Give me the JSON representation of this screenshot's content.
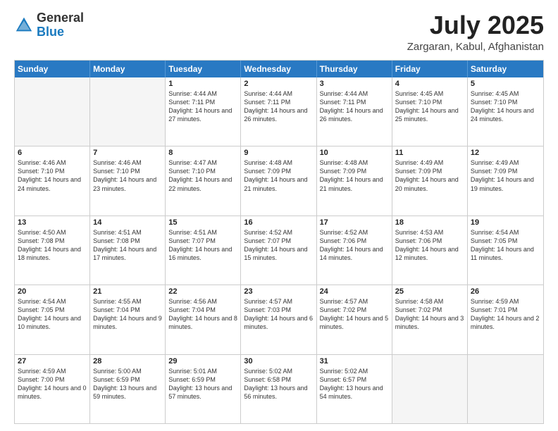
{
  "header": {
    "logo_general": "General",
    "logo_blue": "Blue",
    "month_title": "July 2025",
    "location": "Zargaran, Kabul, Afghanistan"
  },
  "calendar": {
    "days": [
      "Sunday",
      "Monday",
      "Tuesday",
      "Wednesday",
      "Thursday",
      "Friday",
      "Saturday"
    ],
    "rows": [
      [
        {
          "day": "",
          "empty": true
        },
        {
          "day": "",
          "empty": true
        },
        {
          "day": "1",
          "sunrise": "4:44 AM",
          "sunset": "7:11 PM",
          "daylight": "14 hours and 27 minutes."
        },
        {
          "day": "2",
          "sunrise": "4:44 AM",
          "sunset": "7:11 PM",
          "daylight": "14 hours and 26 minutes."
        },
        {
          "day": "3",
          "sunrise": "4:44 AM",
          "sunset": "7:11 PM",
          "daylight": "14 hours and 26 minutes."
        },
        {
          "day": "4",
          "sunrise": "4:45 AM",
          "sunset": "7:10 PM",
          "daylight": "14 hours and 25 minutes."
        },
        {
          "day": "5",
          "sunrise": "4:45 AM",
          "sunset": "7:10 PM",
          "daylight": "14 hours and 24 minutes."
        }
      ],
      [
        {
          "day": "6",
          "sunrise": "4:46 AM",
          "sunset": "7:10 PM",
          "daylight": "14 hours and 24 minutes."
        },
        {
          "day": "7",
          "sunrise": "4:46 AM",
          "sunset": "7:10 PM",
          "daylight": "14 hours and 23 minutes."
        },
        {
          "day": "8",
          "sunrise": "4:47 AM",
          "sunset": "7:10 PM",
          "daylight": "14 hours and 22 minutes."
        },
        {
          "day": "9",
          "sunrise": "4:48 AM",
          "sunset": "7:09 PM",
          "daylight": "14 hours and 21 minutes."
        },
        {
          "day": "10",
          "sunrise": "4:48 AM",
          "sunset": "7:09 PM",
          "daylight": "14 hours and 21 minutes."
        },
        {
          "day": "11",
          "sunrise": "4:49 AM",
          "sunset": "7:09 PM",
          "daylight": "14 hours and 20 minutes."
        },
        {
          "day": "12",
          "sunrise": "4:49 AM",
          "sunset": "7:09 PM",
          "daylight": "14 hours and 19 minutes."
        }
      ],
      [
        {
          "day": "13",
          "sunrise": "4:50 AM",
          "sunset": "7:08 PM",
          "daylight": "14 hours and 18 minutes."
        },
        {
          "day": "14",
          "sunrise": "4:51 AM",
          "sunset": "7:08 PM",
          "daylight": "14 hours and 17 minutes."
        },
        {
          "day": "15",
          "sunrise": "4:51 AM",
          "sunset": "7:07 PM",
          "daylight": "14 hours and 16 minutes."
        },
        {
          "day": "16",
          "sunrise": "4:52 AM",
          "sunset": "7:07 PM",
          "daylight": "14 hours and 15 minutes."
        },
        {
          "day": "17",
          "sunrise": "4:52 AM",
          "sunset": "7:06 PM",
          "daylight": "14 hours and 14 minutes."
        },
        {
          "day": "18",
          "sunrise": "4:53 AM",
          "sunset": "7:06 PM",
          "daylight": "14 hours and 12 minutes."
        },
        {
          "day": "19",
          "sunrise": "4:54 AM",
          "sunset": "7:05 PM",
          "daylight": "14 hours and 11 minutes."
        }
      ],
      [
        {
          "day": "20",
          "sunrise": "4:54 AM",
          "sunset": "7:05 PM",
          "daylight": "14 hours and 10 minutes."
        },
        {
          "day": "21",
          "sunrise": "4:55 AM",
          "sunset": "7:04 PM",
          "daylight": "14 hours and 9 minutes."
        },
        {
          "day": "22",
          "sunrise": "4:56 AM",
          "sunset": "7:04 PM",
          "daylight": "14 hours and 8 minutes."
        },
        {
          "day": "23",
          "sunrise": "4:57 AM",
          "sunset": "7:03 PM",
          "daylight": "14 hours and 6 minutes."
        },
        {
          "day": "24",
          "sunrise": "4:57 AM",
          "sunset": "7:02 PM",
          "daylight": "14 hours and 5 minutes."
        },
        {
          "day": "25",
          "sunrise": "4:58 AM",
          "sunset": "7:02 PM",
          "daylight": "14 hours and 3 minutes."
        },
        {
          "day": "26",
          "sunrise": "4:59 AM",
          "sunset": "7:01 PM",
          "daylight": "14 hours and 2 minutes."
        }
      ],
      [
        {
          "day": "27",
          "sunrise": "4:59 AM",
          "sunset": "7:00 PM",
          "daylight": "14 hours and 0 minutes."
        },
        {
          "day": "28",
          "sunrise": "5:00 AM",
          "sunset": "6:59 PM",
          "daylight": "13 hours and 59 minutes."
        },
        {
          "day": "29",
          "sunrise": "5:01 AM",
          "sunset": "6:59 PM",
          "daylight": "13 hours and 57 minutes."
        },
        {
          "day": "30",
          "sunrise": "5:02 AM",
          "sunset": "6:58 PM",
          "daylight": "13 hours and 56 minutes."
        },
        {
          "day": "31",
          "sunrise": "5:02 AM",
          "sunset": "6:57 PM",
          "daylight": "13 hours and 54 minutes."
        },
        {
          "day": "",
          "empty": true
        },
        {
          "day": "",
          "empty": true
        }
      ]
    ]
  }
}
